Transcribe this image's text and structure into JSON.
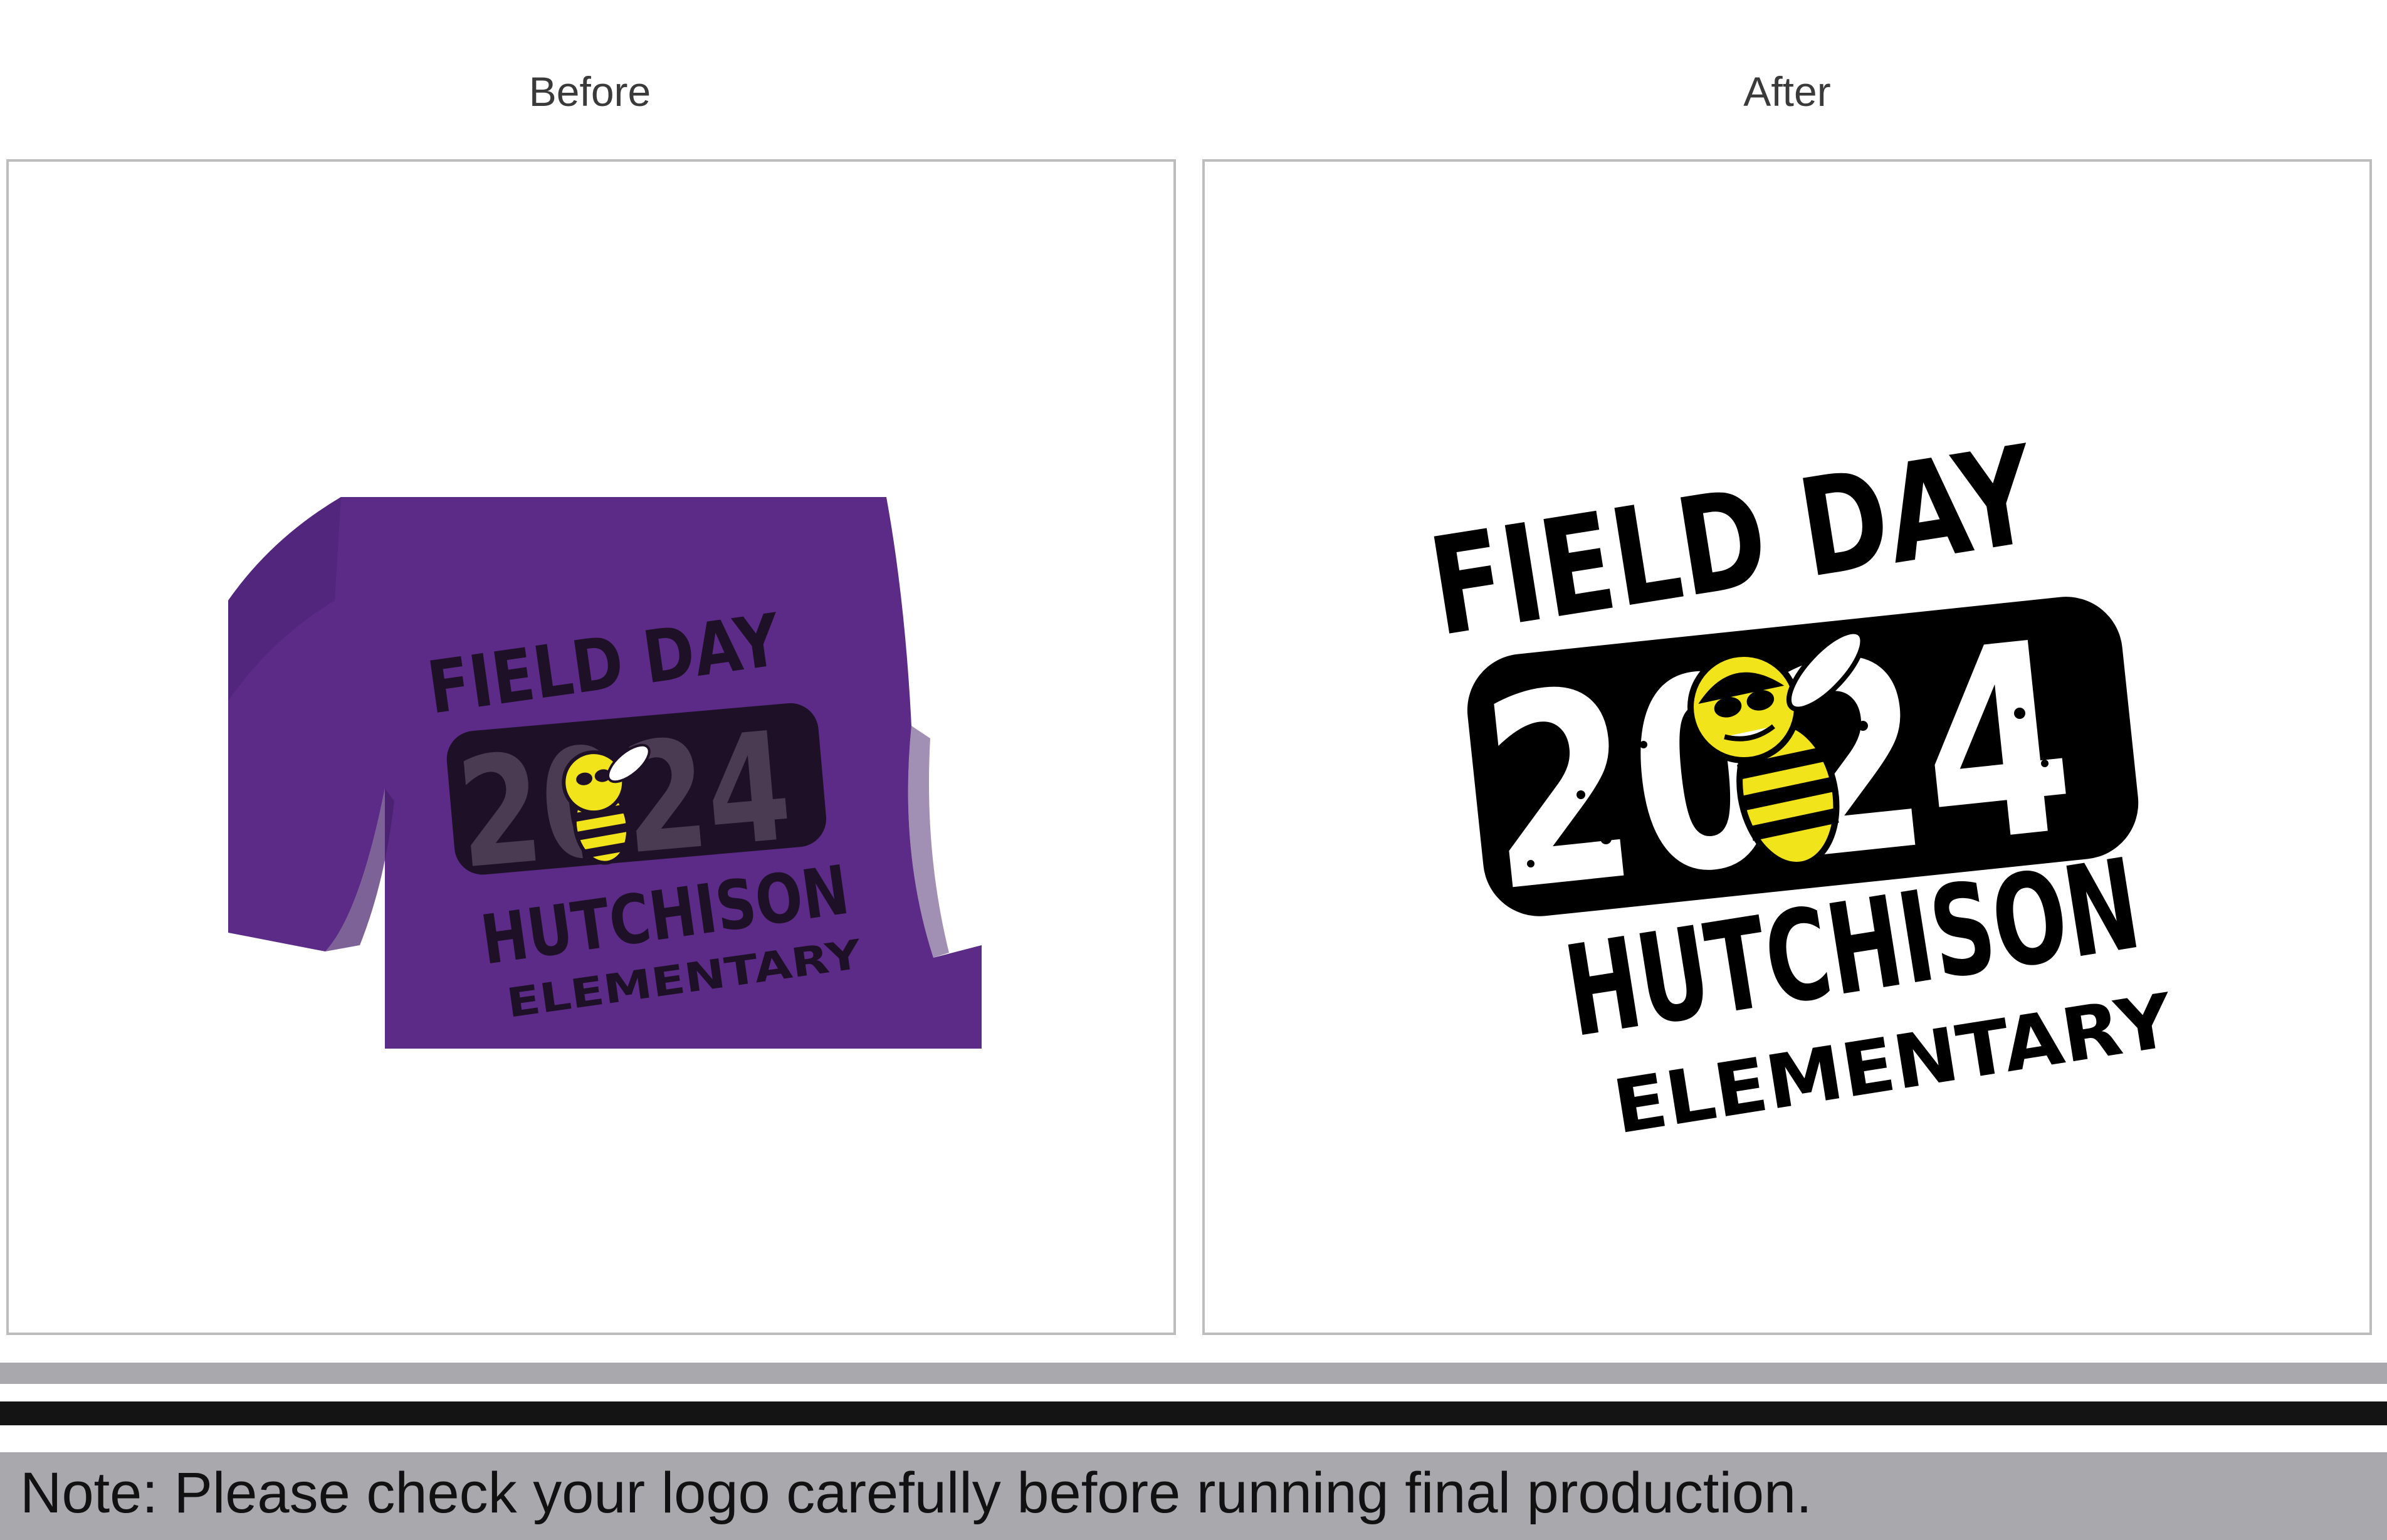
{
  "labels": {
    "before": "Before",
    "after": "After"
  },
  "design": {
    "line1": "FIELD DAY",
    "year": "2024",
    "line3": "HUTCHISON",
    "line4": "ELEMENTARY",
    "mascot_icon": "hornet-mascot-icon"
  },
  "colors": {
    "shirt": "#5b2b87",
    "ink_before": "#1e1026",
    "ink_after": "#000000",
    "mascot_yellow": "#f2e41a",
    "border": "#bdbdbd",
    "bar_gray": "#a9a9ad",
    "bar_black": "#141414"
  },
  "note": {
    "text": "Note: Please check your logo carefully before running final production."
  }
}
